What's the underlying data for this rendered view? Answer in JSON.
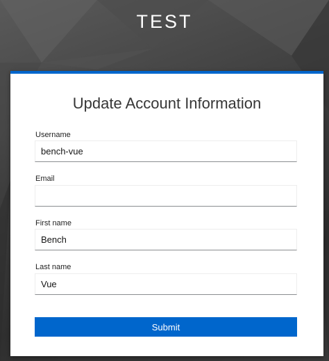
{
  "realm": {
    "title": "TEST"
  },
  "form": {
    "heading": "Update Account Information",
    "fields": [
      {
        "label": "Username",
        "value": "bench-vue"
      },
      {
        "label": "Email",
        "value": ""
      },
      {
        "label": "First name",
        "value": "Bench"
      },
      {
        "label": "Last name",
        "value": "Vue"
      }
    ],
    "submit_label": "Submit"
  },
  "colors": {
    "accent": "#0066cc",
    "background": "#3e3e3e",
    "card": "#ffffff"
  }
}
